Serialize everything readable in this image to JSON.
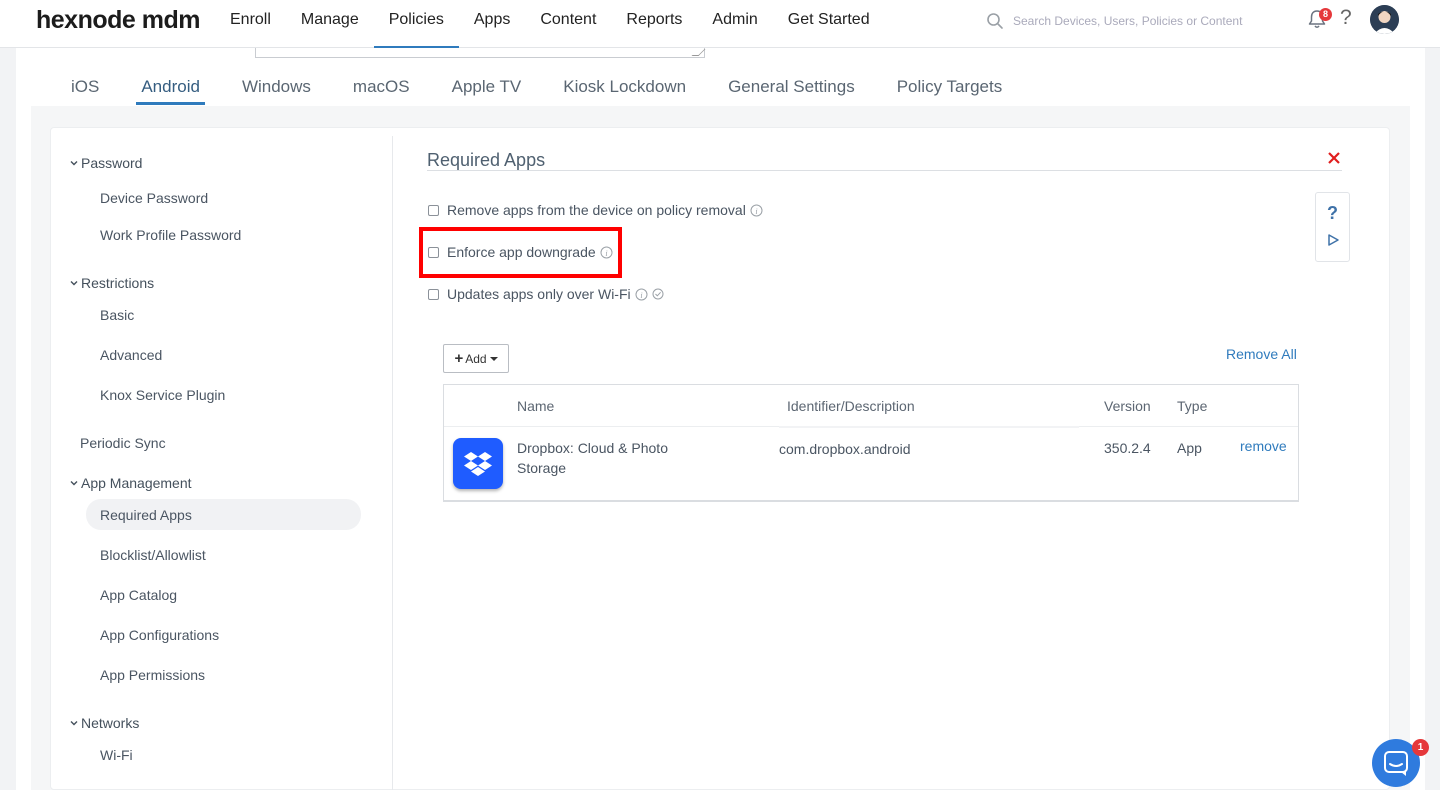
{
  "app": {
    "logo": "hexnode mdm"
  },
  "nav": {
    "items": [
      {
        "label": "Enroll"
      },
      {
        "label": "Manage"
      },
      {
        "label": "Policies"
      },
      {
        "label": "Apps"
      },
      {
        "label": "Content"
      },
      {
        "label": "Reports"
      },
      {
        "label": "Admin"
      },
      {
        "label": "Get Started"
      }
    ],
    "active": "Policies"
  },
  "search": {
    "placeholder": "Search Devices, Users, Policies or Content"
  },
  "notifications": {
    "count": "8"
  },
  "platform_tabs": {
    "items": [
      {
        "label": "iOS"
      },
      {
        "label": "Android"
      },
      {
        "label": "Windows"
      },
      {
        "label": "macOS"
      },
      {
        "label": "Apple TV"
      },
      {
        "label": "Kiosk Lockdown"
      },
      {
        "label": "General Settings"
      },
      {
        "label": "Policy Targets"
      }
    ],
    "active": "Android"
  },
  "sidebar": {
    "groups": [
      {
        "label": "Password",
        "items": [
          "Device Password",
          "Work Profile Password"
        ]
      },
      {
        "label": "Restrictions",
        "items": [
          "Basic",
          "Advanced",
          "Knox Service Plugin"
        ]
      },
      {
        "label": "Periodic Sync"
      },
      {
        "label": "App Management",
        "items": [
          "Required Apps",
          "Blocklist/Allowlist",
          "App Catalog",
          "App Configurations",
          "App Permissions"
        ]
      },
      {
        "label": "Networks",
        "items": [
          "Wi-Fi"
        ]
      }
    ],
    "active_item": "Required Apps"
  },
  "section": {
    "title": "Required Apps",
    "options": [
      {
        "label": "Remove apps from the device on policy removal",
        "checked": false
      },
      {
        "label": "Enforce app downgrade",
        "checked": false,
        "highlighted": true
      },
      {
        "label": "Updates apps only over Wi-Fi",
        "checked": false
      }
    ],
    "add_label": "Add",
    "remove_all_label": "Remove All"
  },
  "table": {
    "columns": [
      "Name",
      "Identifier/Description",
      "Version",
      "Type"
    ],
    "rows": [
      {
        "icon": "dropbox-icon",
        "name_line1": "Dropbox: Cloud & Photo",
        "name_line2": "Storage",
        "identifier": "com.dropbox.android",
        "version": "350.2.4",
        "type": "App",
        "action": "remove"
      }
    ]
  },
  "chat": {
    "badge": "1"
  },
  "colors": {
    "accent": "#2f7bbd",
    "highlight": "#ff0000",
    "dropbox": "#1f5cff",
    "danger": "#e5383b"
  }
}
